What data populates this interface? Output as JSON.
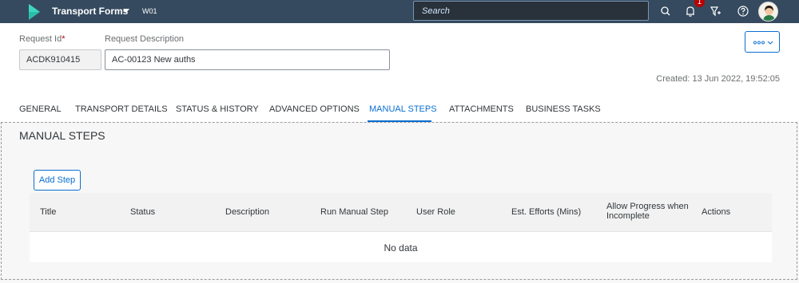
{
  "shell": {
    "app_title": "Transport Forms",
    "app_subtitle": "W01",
    "search_placeholder": "Search",
    "notification_count": "1",
    "icons": [
      "search-icon",
      "bell-icon",
      "filter-icon",
      "help-icon",
      "avatar"
    ]
  },
  "header": {
    "request_id_label": "Request Id",
    "request_id_required": "*",
    "request_id_value": "ACDK910415",
    "request_desc_label": "Request Description",
    "request_desc_value": "AC-00123 New auths",
    "more_button": "overflow-icon",
    "created": "Created: 13 Jun 2022, 19:52:05"
  },
  "tabs": [
    {
      "label": "GENERAL"
    },
    {
      "label": "TRANSPORT DETAILS"
    },
    {
      "label": "STATUS & HISTORY"
    },
    {
      "label": "ADVANCED OPTIONS"
    },
    {
      "label": "MANUAL STEPS",
      "active": true
    },
    {
      "label": "ATTACHMENTS"
    },
    {
      "label": "BUSINESS TASKS"
    }
  ],
  "section": {
    "title": "MANUAL STEPS",
    "add_button": "Add Step",
    "columns": [
      "Title",
      "Status",
      "Description",
      "Run Manual Step",
      "User Role",
      "Est. Efforts (Mins)",
      "Allow Progress when Incomplete",
      "Actions"
    ],
    "empty_text": "No data"
  },
  "colors": {
    "shell_bg": "#354a5f",
    "accent": "#0a6ed1",
    "required": "#bb0000"
  }
}
